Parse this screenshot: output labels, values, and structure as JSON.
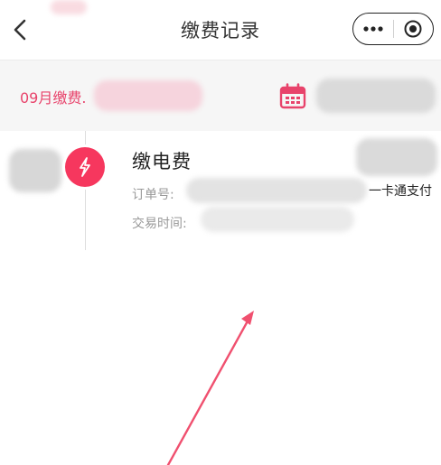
{
  "header": {
    "title": "缴费记录",
    "back_icon": "chevron-left-icon",
    "capsule": {
      "more_icon": "more-dots-icon",
      "close_icon": "target-circle-icon"
    }
  },
  "filter": {
    "month_label": "09月缴费.",
    "calendar_icon": "calendar-icon",
    "accent_color": "#e8436b"
  },
  "records": [
    {
      "icon": "lightning-icon",
      "title": "缴电费",
      "order_label": "订单号:",
      "time_label": "交易时间:",
      "payment_method": "一卡通支付"
    }
  ],
  "annotation": {
    "color": "#f0506f"
  }
}
